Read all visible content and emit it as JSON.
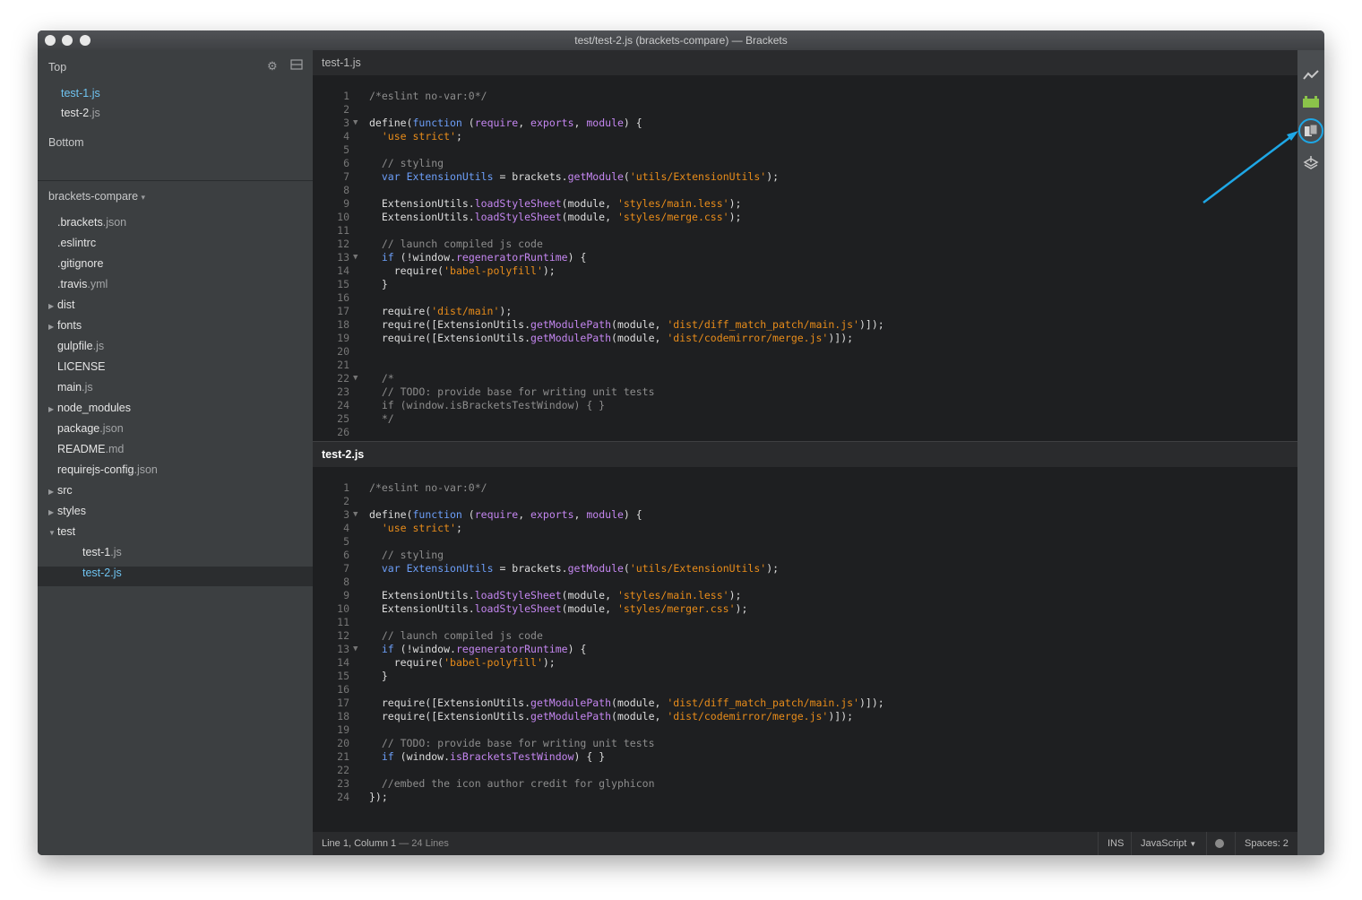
{
  "window": {
    "title": "test/test-2.js (brackets-compare) — Brackets",
    "controls": [
      "close",
      "minimize",
      "zoom"
    ]
  },
  "sidebar": {
    "working_set": {
      "top_label": "Top",
      "files": [
        {
          "name": "test-1",
          "ext": ".js",
          "active": true
        },
        {
          "name": "test-2",
          "ext": ".js",
          "active": false
        }
      ],
      "bottom_label": "Bottom"
    },
    "project": {
      "name": "brackets-compare",
      "caret": "▾",
      "items": [
        {
          "name": ".brackets",
          "ext": ".json",
          "type": "file",
          "depth": 0
        },
        {
          "name": ".eslintrc",
          "ext": "",
          "type": "file",
          "depth": 0
        },
        {
          "name": ".gitignore",
          "ext": "",
          "type": "file",
          "depth": 0
        },
        {
          "name": ".travis",
          "ext": ".yml",
          "type": "file",
          "depth": 0
        },
        {
          "name": "dist",
          "ext": "",
          "type": "folder",
          "open": false,
          "depth": 0
        },
        {
          "name": "fonts",
          "ext": "",
          "type": "folder",
          "open": false,
          "depth": 0
        },
        {
          "name": "gulpfile",
          "ext": ".js",
          "type": "file",
          "depth": 0
        },
        {
          "name": "LICENSE",
          "ext": "",
          "type": "file",
          "depth": 0
        },
        {
          "name": "main",
          "ext": ".js",
          "type": "file",
          "depth": 0
        },
        {
          "name": "node_modules",
          "ext": "",
          "type": "folder",
          "open": false,
          "depth": 0
        },
        {
          "name": "package",
          "ext": ".json",
          "type": "file",
          "depth": 0
        },
        {
          "name": "README",
          "ext": ".md",
          "type": "file",
          "depth": 0
        },
        {
          "name": "requirejs-config",
          "ext": ".json",
          "type": "file",
          "depth": 0
        },
        {
          "name": "src",
          "ext": "",
          "type": "folder",
          "open": false,
          "depth": 0
        },
        {
          "name": "styles",
          "ext": "",
          "type": "folder",
          "open": false,
          "depth": 0
        },
        {
          "name": "test",
          "ext": "",
          "type": "folder",
          "open": true,
          "depth": 0
        },
        {
          "name": "test-1",
          "ext": ".js",
          "type": "file",
          "depth": 1
        },
        {
          "name": "test-2",
          "ext": ".js",
          "type": "file",
          "depth": 1,
          "selected": true
        }
      ]
    }
  },
  "editor": {
    "panes": [
      {
        "tab": "test-1.js",
        "lines": [
          {
            "n": "1",
            "fold": false,
            "seg": [
              [
                "c",
                "/*eslint no-var:0*/"
              ]
            ]
          },
          {
            "n": "2",
            "fold": false,
            "seg": []
          },
          {
            "n": "3",
            "fold": true,
            "seg": [
              [
                "p",
                "define("
              ],
              [
                "k",
                "function"
              ],
              [
                "p",
                " ("
              ],
              [
                "f",
                "require"
              ],
              [
                "p",
                ", "
              ],
              [
                "f",
                "exports"
              ],
              [
                "p",
                ", "
              ],
              [
                "f",
                "module"
              ],
              [
                "p",
                ") {"
              ]
            ]
          },
          {
            "n": "4",
            "fold": false,
            "seg": [
              [
                "p",
                "  "
              ],
              [
                "s",
                "'use strict'"
              ],
              [
                "p",
                ";"
              ]
            ]
          },
          {
            "n": "5",
            "fold": false,
            "seg": []
          },
          {
            "n": "6",
            "fold": false,
            "seg": [
              [
                "p",
                "  "
              ],
              [
                "c",
                "// styling"
              ]
            ]
          },
          {
            "n": "7",
            "fold": false,
            "seg": [
              [
                "p",
                "  "
              ],
              [
                "k",
                "var"
              ],
              [
                "p",
                " "
              ],
              [
                "v",
                "ExtensionUtils"
              ],
              [
                "p",
                " = brackets."
              ],
              [
                "f",
                "getModule"
              ],
              [
                "p",
                "("
              ],
              [
                "s",
                "'utils/ExtensionUtils'"
              ],
              [
                "p",
                ");"
              ]
            ]
          },
          {
            "n": "8",
            "fold": false,
            "seg": []
          },
          {
            "n": "9",
            "fold": false,
            "seg": [
              [
                "p",
                "  ExtensionUtils."
              ],
              [
                "f",
                "loadStyleSheet"
              ],
              [
                "p",
                "(module, "
              ],
              [
                "s",
                "'styles/main.less'"
              ],
              [
                "p",
                ");"
              ]
            ]
          },
          {
            "n": "10",
            "fold": false,
            "seg": [
              [
                "p",
                "  ExtensionUtils."
              ],
              [
                "f",
                "loadStyleSheet"
              ],
              [
                "p",
                "(module, "
              ],
              [
                "s",
                "'styles/merge.css'"
              ],
              [
                "p",
                ");"
              ]
            ]
          },
          {
            "n": "11",
            "fold": false,
            "seg": []
          },
          {
            "n": "12",
            "fold": false,
            "seg": [
              [
                "p",
                "  "
              ],
              [
                "c",
                "// launch compiled js code"
              ]
            ]
          },
          {
            "n": "13",
            "fold": true,
            "seg": [
              [
                "p",
                "  "
              ],
              [
                "k",
                "if"
              ],
              [
                "p",
                " (!window."
              ],
              [
                "f",
                "regeneratorRuntime"
              ],
              [
                "p",
                ") {"
              ]
            ]
          },
          {
            "n": "14",
            "fold": false,
            "seg": [
              [
                "p",
                "    require("
              ],
              [
                "s",
                "'babel-polyfill'"
              ],
              [
                "p",
                ");"
              ]
            ]
          },
          {
            "n": "15",
            "fold": false,
            "seg": [
              [
                "p",
                "  }"
              ]
            ]
          },
          {
            "n": "16",
            "fold": false,
            "seg": []
          },
          {
            "n": "17",
            "fold": false,
            "seg": [
              [
                "p",
                "  require("
              ],
              [
                "s",
                "'dist/main'"
              ],
              [
                "p",
                ");"
              ]
            ]
          },
          {
            "n": "18",
            "fold": false,
            "seg": [
              [
                "p",
                "  require([ExtensionUtils."
              ],
              [
                "f",
                "getModulePath"
              ],
              [
                "p",
                "(module, "
              ],
              [
                "s",
                "'dist/diff_match_patch/main.js'"
              ],
              [
                "p",
                ")]);"
              ]
            ]
          },
          {
            "n": "19",
            "fold": false,
            "seg": [
              [
                "p",
                "  require([ExtensionUtils."
              ],
              [
                "f",
                "getModulePath"
              ],
              [
                "p",
                "(module, "
              ],
              [
                "s",
                "'dist/codemirror/merge.js'"
              ],
              [
                "p",
                ")]);"
              ]
            ]
          },
          {
            "n": "20",
            "fold": false,
            "seg": []
          },
          {
            "n": "21",
            "fold": false,
            "seg": []
          },
          {
            "n": "22",
            "fold": true,
            "seg": [
              [
                "p",
                "  "
              ],
              [
                "c",
                "/*"
              ]
            ]
          },
          {
            "n": "23",
            "fold": false,
            "seg": [
              [
                "p",
                "  "
              ],
              [
                "c",
                "// TODO: provide base for writing unit tests"
              ]
            ]
          },
          {
            "n": "24",
            "fold": false,
            "seg": [
              [
                "p",
                "  "
              ],
              [
                "c",
                "if (window.isBracketsTestWindow) { }"
              ]
            ]
          },
          {
            "n": "25",
            "fold": false,
            "seg": [
              [
                "p",
                "  "
              ],
              [
                "c",
                "*/"
              ]
            ]
          },
          {
            "n": "26",
            "fold": false,
            "seg": []
          }
        ]
      },
      {
        "tab": "test-2.js",
        "lines": [
          {
            "n": "1",
            "fold": false,
            "seg": [
              [
                "c",
                "/*eslint no-var:0*/"
              ]
            ]
          },
          {
            "n": "2",
            "fold": false,
            "seg": []
          },
          {
            "n": "3",
            "fold": true,
            "seg": [
              [
                "p",
                "define("
              ],
              [
                "k",
                "function"
              ],
              [
                "p",
                " ("
              ],
              [
                "f",
                "require"
              ],
              [
                "p",
                ", "
              ],
              [
                "f",
                "exports"
              ],
              [
                "p",
                ", "
              ],
              [
                "f",
                "module"
              ],
              [
                "p",
                ") {"
              ]
            ]
          },
          {
            "n": "4",
            "fold": false,
            "seg": [
              [
                "p",
                "  "
              ],
              [
                "s",
                "'use strict'"
              ],
              [
                "p",
                ";"
              ]
            ]
          },
          {
            "n": "5",
            "fold": false,
            "seg": []
          },
          {
            "n": "6",
            "fold": false,
            "seg": [
              [
                "p",
                "  "
              ],
              [
                "c",
                "// styling"
              ]
            ]
          },
          {
            "n": "7",
            "fold": false,
            "seg": [
              [
                "p",
                "  "
              ],
              [
                "k",
                "var"
              ],
              [
                "p",
                " "
              ],
              [
                "v",
                "ExtensionUtils"
              ],
              [
                "p",
                " = brackets."
              ],
              [
                "f",
                "getModule"
              ],
              [
                "p",
                "("
              ],
              [
                "s",
                "'utils/ExtensionUtils'"
              ],
              [
                "p",
                ");"
              ]
            ]
          },
          {
            "n": "8",
            "fold": false,
            "seg": []
          },
          {
            "n": "9",
            "fold": false,
            "seg": [
              [
                "p",
                "  ExtensionUtils."
              ],
              [
                "f",
                "loadStyleSheet"
              ],
              [
                "p",
                "(module, "
              ],
              [
                "s",
                "'styles/main.less'"
              ],
              [
                "p",
                ");"
              ]
            ]
          },
          {
            "n": "10",
            "fold": false,
            "seg": [
              [
                "p",
                "  ExtensionUtils."
              ],
              [
                "f",
                "loadStyleSheet"
              ],
              [
                "p",
                "(module, "
              ],
              [
                "s",
                "'styles/merger.css'"
              ],
              [
                "p",
                ");"
              ]
            ]
          },
          {
            "n": "11",
            "fold": false,
            "seg": []
          },
          {
            "n": "12",
            "fold": false,
            "seg": [
              [
                "p",
                "  "
              ],
              [
                "c",
                "// launch compiled js code"
              ]
            ]
          },
          {
            "n": "13",
            "fold": true,
            "seg": [
              [
                "p",
                "  "
              ],
              [
                "k",
                "if"
              ],
              [
                "p",
                " (!window."
              ],
              [
                "f",
                "regeneratorRuntime"
              ],
              [
                "p",
                ") {"
              ]
            ]
          },
          {
            "n": "14",
            "fold": false,
            "seg": [
              [
                "p",
                "    require("
              ],
              [
                "s",
                "'babel-polyfill'"
              ],
              [
                "p",
                ");"
              ]
            ]
          },
          {
            "n": "15",
            "fold": false,
            "seg": [
              [
                "p",
                "  }"
              ]
            ]
          },
          {
            "n": "16",
            "fold": false,
            "seg": []
          },
          {
            "n": "17",
            "fold": false,
            "seg": [
              [
                "p",
                "  require([ExtensionUtils."
              ],
              [
                "f",
                "getModulePath"
              ],
              [
                "p",
                "(module, "
              ],
              [
                "s",
                "'dist/diff_match_patch/main.js'"
              ],
              [
                "p",
                ")]);"
              ]
            ]
          },
          {
            "n": "18",
            "fold": false,
            "seg": [
              [
                "p",
                "  require([ExtensionUtils."
              ],
              [
                "f",
                "getModulePath"
              ],
              [
                "p",
                "(module, "
              ],
              [
                "s",
                "'dist/codemirror/merge.js'"
              ],
              [
                "p",
                ")]);"
              ]
            ]
          },
          {
            "n": "19",
            "fold": false,
            "seg": []
          },
          {
            "n": "20",
            "fold": false,
            "seg": [
              [
                "p",
                "  "
              ],
              [
                "c",
                "// TODO: provide base for writing unit tests"
              ]
            ]
          },
          {
            "n": "21",
            "fold": false,
            "seg": [
              [
                "p",
                "  "
              ],
              [
                "k",
                "if"
              ],
              [
                "p",
                " (window."
              ],
              [
                "f",
                "isBracketsTestWindow"
              ],
              [
                "p",
                ") { }"
              ]
            ]
          },
          {
            "n": "22",
            "fold": false,
            "seg": []
          },
          {
            "n": "23",
            "fold": false,
            "seg": [
              [
                "p",
                "  "
              ],
              [
                "c",
                "//embed the icon author credit for glyphicon"
              ]
            ]
          },
          {
            "n": "24",
            "fold": false,
            "seg": [
              [
                "p",
                "});"
              ]
            ]
          }
        ]
      }
    ]
  },
  "statusbar": {
    "position": "Line 1, Column 1",
    "line_count": " — 24 Lines",
    "mode": "INS",
    "language": "JavaScript",
    "spaces": "Spaces:  2"
  },
  "toolbar": {
    "icons": [
      "live-preview-icon",
      "extension-manager-icon",
      "compare-files-icon",
      "deploy-icon"
    ]
  },
  "colors": {
    "keyword": "#6c9ef8",
    "string": "#e88c1a",
    "function": "#c486f0",
    "comment": "#8d8d8d",
    "annotation_arrow": "#1ea7e6",
    "active_file": "#6fc3f0"
  }
}
